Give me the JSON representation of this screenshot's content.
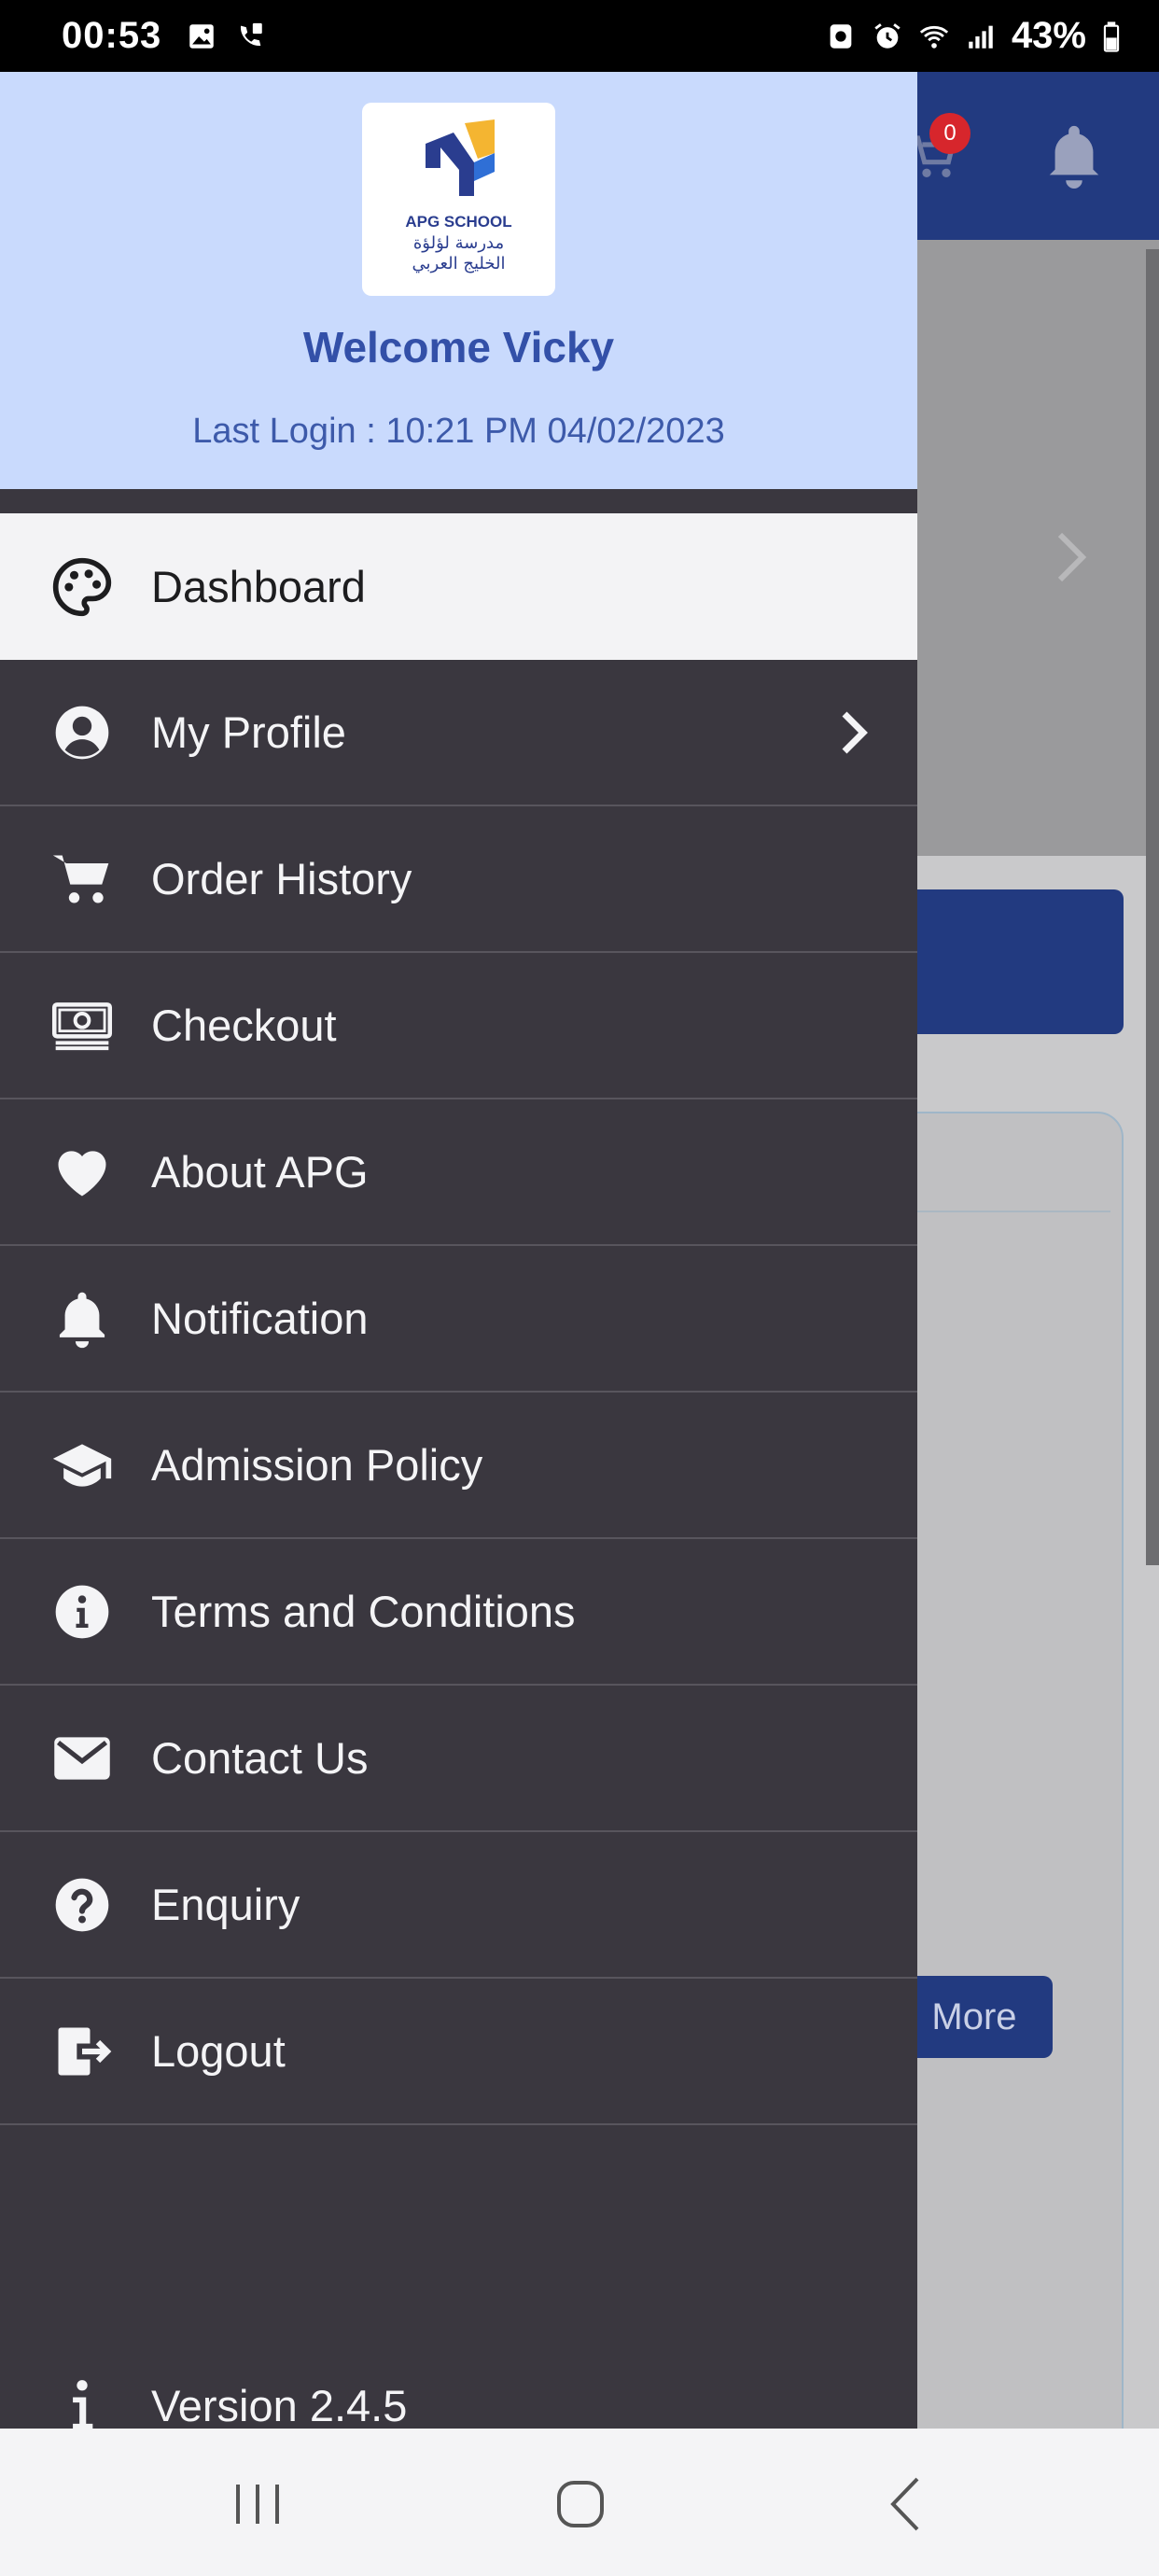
{
  "status": {
    "time": "00:53",
    "battery": "43%"
  },
  "background": {
    "cart_count": "0",
    "more_label": "More"
  },
  "drawer": {
    "logo_text": "APG SCHOOL",
    "logo_arabic_line1": "مدرسة لؤلؤة",
    "logo_arabic_line2": "الخليج العربي",
    "welcome": "Welcome Vicky",
    "last_login": "Last Login : 10:21 PM 04/02/2023",
    "items": [
      {
        "label": "Dashboard",
        "icon": "palette-icon",
        "active": true
      },
      {
        "label": "My Profile",
        "icon": "user-circle-icon",
        "has_submenu": true
      },
      {
        "label": "Order History",
        "icon": "cart-icon"
      },
      {
        "label": "Checkout",
        "icon": "money-icon"
      },
      {
        "label": "About APG",
        "icon": "heart-icon"
      },
      {
        "label": "Notification",
        "icon": "bell-icon"
      },
      {
        "label": "Admission Policy",
        "icon": "graduation-cap-icon"
      },
      {
        "label": "Terms and Conditions",
        "icon": "info-circle-icon"
      },
      {
        "label": "Contact Us",
        "icon": "envelope-icon"
      },
      {
        "label": "Enquiry",
        "icon": "question-circle-icon"
      },
      {
        "label": "Logout",
        "icon": "logout-icon"
      }
    ],
    "version": "Version 2.4.5"
  },
  "colors": {
    "drawer_bg": "#3a373f",
    "header_bg": "#c9dafd",
    "accent": "#3350a8",
    "app_header": "#223a80"
  }
}
